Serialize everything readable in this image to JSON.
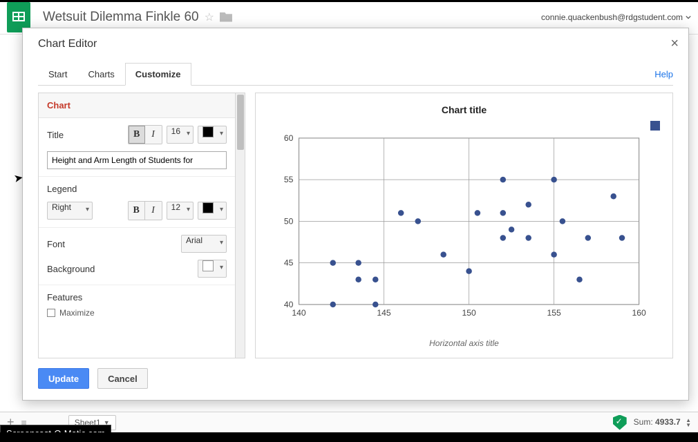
{
  "doc": {
    "title": "Wetsuit Dilemma Finkle 60"
  },
  "user": {
    "email": "connie.quackenbush@rdgstudent.com"
  },
  "dialog": {
    "title": "Chart Editor",
    "help_label": "Help",
    "tabs": [
      "Start",
      "Charts",
      "Customize"
    ],
    "active_tab": 2,
    "footer": {
      "update": "Update",
      "cancel": "Cancel"
    }
  },
  "customize": {
    "section_header": "Chart",
    "title_label": "Title",
    "title_font_size": "16",
    "title_value": "Height and Arm Length of Students for",
    "legend_label": "Legend",
    "legend_position": "Right",
    "legend_font_size": "12",
    "font_label": "Font",
    "font_value": "Arial",
    "background_label": "Background",
    "features_label": "Features",
    "maximize_label": "Maximize"
  },
  "colors": {
    "title_color": "#000000",
    "legend_color": "#000000",
    "background_color": "#ffffff",
    "point_color": "#38518f"
  },
  "preview": {
    "chart_title": "Chart title",
    "haxis_title": "Horizontal axis title"
  },
  "statusbar": {
    "sheet_name": "Sheet1",
    "sum_label": "Sum:",
    "sum_value": "4933.7"
  },
  "badge": "Screencast-O-Matic.com",
  "chart_data": {
    "type": "scatter",
    "title": "Chart title",
    "xlabel": "Horizontal axis title",
    "ylabel": "",
    "xlim": [
      140,
      160
    ],
    "ylim": [
      40,
      60
    ],
    "x_ticks": [
      140,
      145,
      150,
      155,
      160
    ],
    "y_ticks": [
      40,
      45,
      50,
      55,
      60
    ],
    "points": [
      [
        142,
        40
      ],
      [
        144.5,
        40
      ],
      [
        143.5,
        43
      ],
      [
        144.5,
        43
      ],
      [
        156.5,
        43
      ],
      [
        150,
        44
      ],
      [
        142,
        45
      ],
      [
        143.5,
        45
      ],
      [
        148.5,
        46
      ],
      [
        155,
        46
      ],
      [
        152,
        48
      ],
      [
        153.5,
        48
      ],
      [
        157,
        48
      ],
      [
        159,
        48
      ],
      [
        152.5,
        49
      ],
      [
        147,
        50
      ],
      [
        155.5,
        50
      ],
      [
        146,
        51
      ],
      [
        150.5,
        51
      ],
      [
        152,
        51
      ],
      [
        153.5,
        52
      ],
      [
        158.5,
        53
      ],
      [
        152,
        55
      ],
      [
        155,
        55
      ]
    ]
  }
}
